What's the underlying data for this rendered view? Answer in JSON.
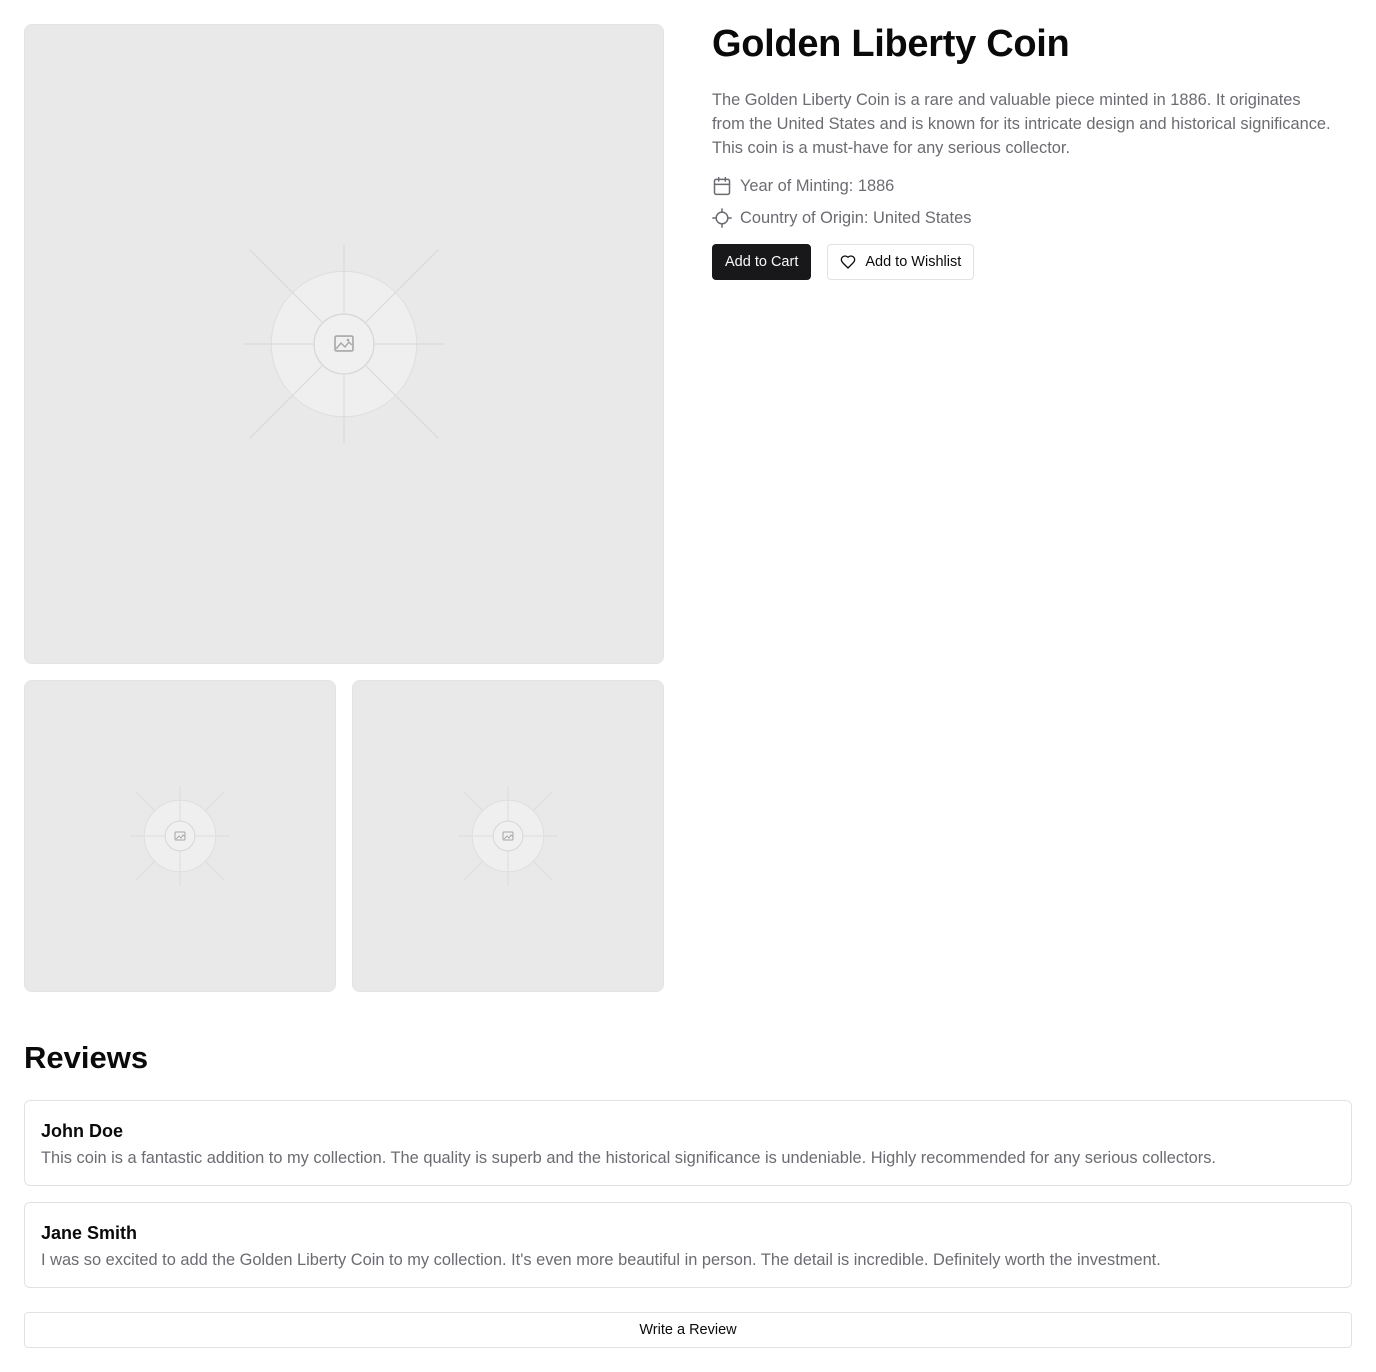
{
  "product": {
    "title": "Golden Liberty Coin",
    "description": "The Golden Liberty Coin is a rare and valuable piece minted in 1886. It originates from the United States and is known for its intricate design and historical significance. This coin is a must-have for any serious collector.",
    "year_label": "Year of Minting: 1886",
    "country_label": "Country of Origin: United States",
    "icons": {
      "year": "calendar-icon",
      "country": "crosshair-icon",
      "wishlist": "heart-icon",
      "image": "image-placeholder-icon"
    }
  },
  "actions": {
    "add_to_cart": "Add to Cart",
    "add_to_wishlist": "Add to Wishlist"
  },
  "reviews": {
    "heading": "Reviews",
    "items": [
      {
        "name": "John Doe",
        "text": "This coin is a fantastic addition to my collection. The quality is superb and the historical significance is undeniable. Highly recommended for any serious collectors."
      },
      {
        "name": "Jane Smith",
        "text": "I was so excited to add the Golden Liberty Coin to my collection. It's even more beautiful in person. The detail is incredible. Definitely worth the investment."
      }
    ],
    "write_label": "Write a Review"
  },
  "colors": {
    "primary_button": "#18181b",
    "muted_text": "#6b6b72",
    "placeholder_bg": "#e9e9e9"
  }
}
